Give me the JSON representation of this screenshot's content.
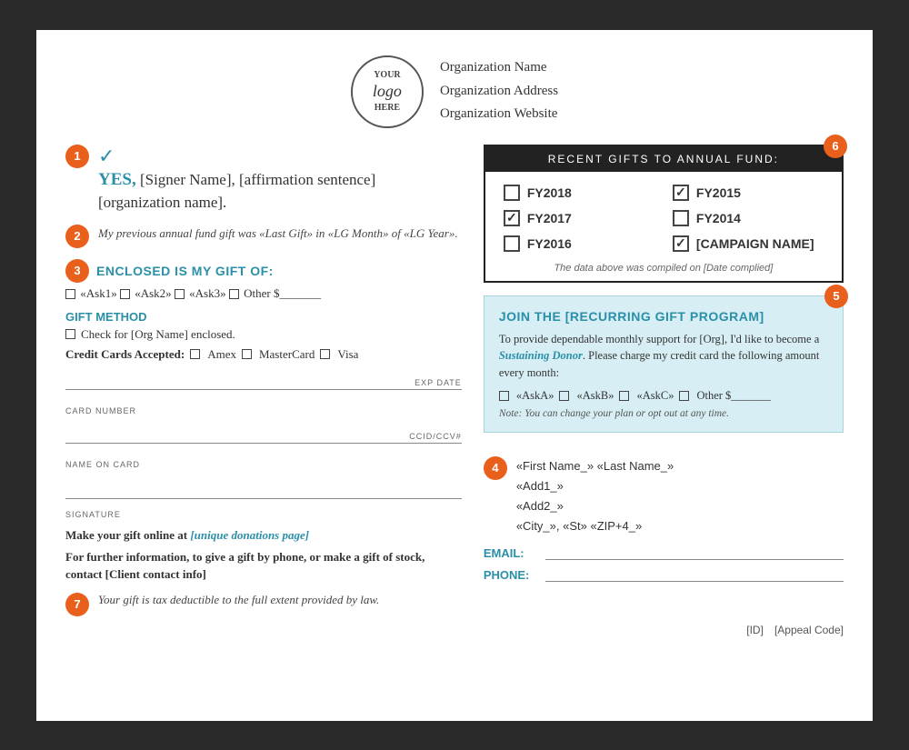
{
  "header": {
    "logo_line1": "YOUR",
    "logo_italic": "logo",
    "logo_line3": "HERE",
    "org_name": "Organization Name",
    "org_address": "Organization Address",
    "org_website": "Organization Website"
  },
  "section1": {
    "badge": "1",
    "yes_label": "YES,",
    "text": " [Signer Name], [affirmation sentence] [organization name]."
  },
  "section2": {
    "badge": "2",
    "text": "My previous annual fund gift was «Last Gift» in «LG Month» of «LG Year»."
  },
  "section3": {
    "badge": "3",
    "title": "ENCLOSED IS MY GIFT OF:",
    "options": [
      "«Ask1»",
      "«Ask2»",
      "«Ask3»",
      "Other $_______"
    ],
    "gift_method_title": "GIFT METHOD",
    "check_label": "Check for [Org Name] enclosed.",
    "credit_label": "Credit Cards Accepted:",
    "credit_options": [
      "Amex",
      "MasterCard",
      "Visa"
    ],
    "card_number_label": "CARD NUMBER",
    "exp_date_label": "EXP DATE",
    "name_on_card_label": "NAME ON CARD",
    "ccid_label": "CCID/CCV#",
    "signature_label": "SIGNATURE"
  },
  "online_gift": {
    "text": "Make your gift online at ",
    "link": "[unique donations page]"
  },
  "contact_info": {
    "text": "For further information, to give a gift by phone, or make a gift of stock, contact [Client contact info]"
  },
  "section7": {
    "badge": "7",
    "text": "Your gift is tax deductible to the full extent provided by law."
  },
  "recent_gifts": {
    "badge": "6",
    "header": "RECENT GIFTS TO ANNUAL FUND:",
    "items": [
      {
        "label": "FY2018",
        "checked": false
      },
      {
        "label": "FY2015",
        "checked": true
      },
      {
        "label": "FY2017",
        "checked": true
      },
      {
        "label": "FY2014",
        "checked": false
      },
      {
        "label": "FY2016",
        "checked": false
      },
      {
        "label": "[CAMPAIGN NAME]",
        "checked": true
      }
    ],
    "footnote": "The data above was compiled on [Date complied]"
  },
  "join_program": {
    "badge": "5",
    "title": "JOIN THE [RECURRING GIFT PROGRAM]",
    "text_before": "To provide dependable monthly support for [Org], I'd like to become a ",
    "link": "Sustaining Donor",
    "text_after": ". Please charge my credit card the following amount every month:",
    "options": [
      "«AskA»",
      "«AskB»",
      "«AskC»",
      "Other $_______"
    ],
    "note": "Note: You can change your plan or opt out at any time."
  },
  "address": {
    "badge": "4",
    "lines": [
      "«First Name_» «Last Name_»",
      "«Add1_»",
      "«Add2_»",
      "«City_», «St» «ZIP+4_»"
    ],
    "email_label": "EMAIL:",
    "phone_label": "PHONE:"
  },
  "footer": {
    "id": "[ID]",
    "appeal_code": "[Appeal Code]"
  }
}
